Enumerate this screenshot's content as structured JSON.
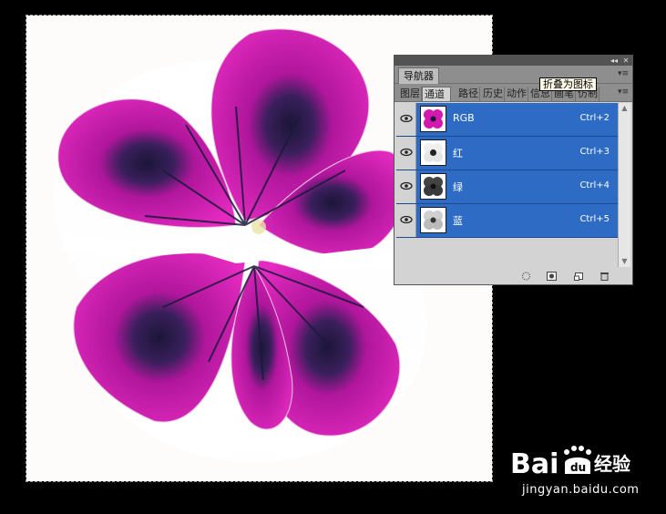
{
  "panel": {
    "tab_navigator": "导航器",
    "tooltip": "折叠为图标",
    "tabs": [
      {
        "label": "图层",
        "active": false
      },
      {
        "label": "通道",
        "active": true
      },
      {
        "label": "路径",
        "active": false
      },
      {
        "label": "历史",
        "active": false
      },
      {
        "label": "动作",
        "active": false
      },
      {
        "label": "信息",
        "active": false
      },
      {
        "label": "画笔",
        "active": false
      },
      {
        "label": "仿制",
        "active": false
      }
    ],
    "channels": [
      {
        "name": "RGB",
        "shortcut": "Ctrl+2",
        "thumb": "color"
      },
      {
        "name": "红",
        "shortcut": "Ctrl+3",
        "thumb": "light"
      },
      {
        "name": "绿",
        "shortcut": "Ctrl+4",
        "thumb": "dark"
      },
      {
        "name": "蓝",
        "shortcut": "Ctrl+5",
        "thumb": "mid"
      }
    ]
  },
  "colors": {
    "selection_blue": "#2e6bc5",
    "petal": "#d318b0",
    "panel_bg": "#d3d3d3"
  },
  "watermark": {
    "logo": "Bai du 经验",
    "url": "jingyan.baidu.com"
  }
}
